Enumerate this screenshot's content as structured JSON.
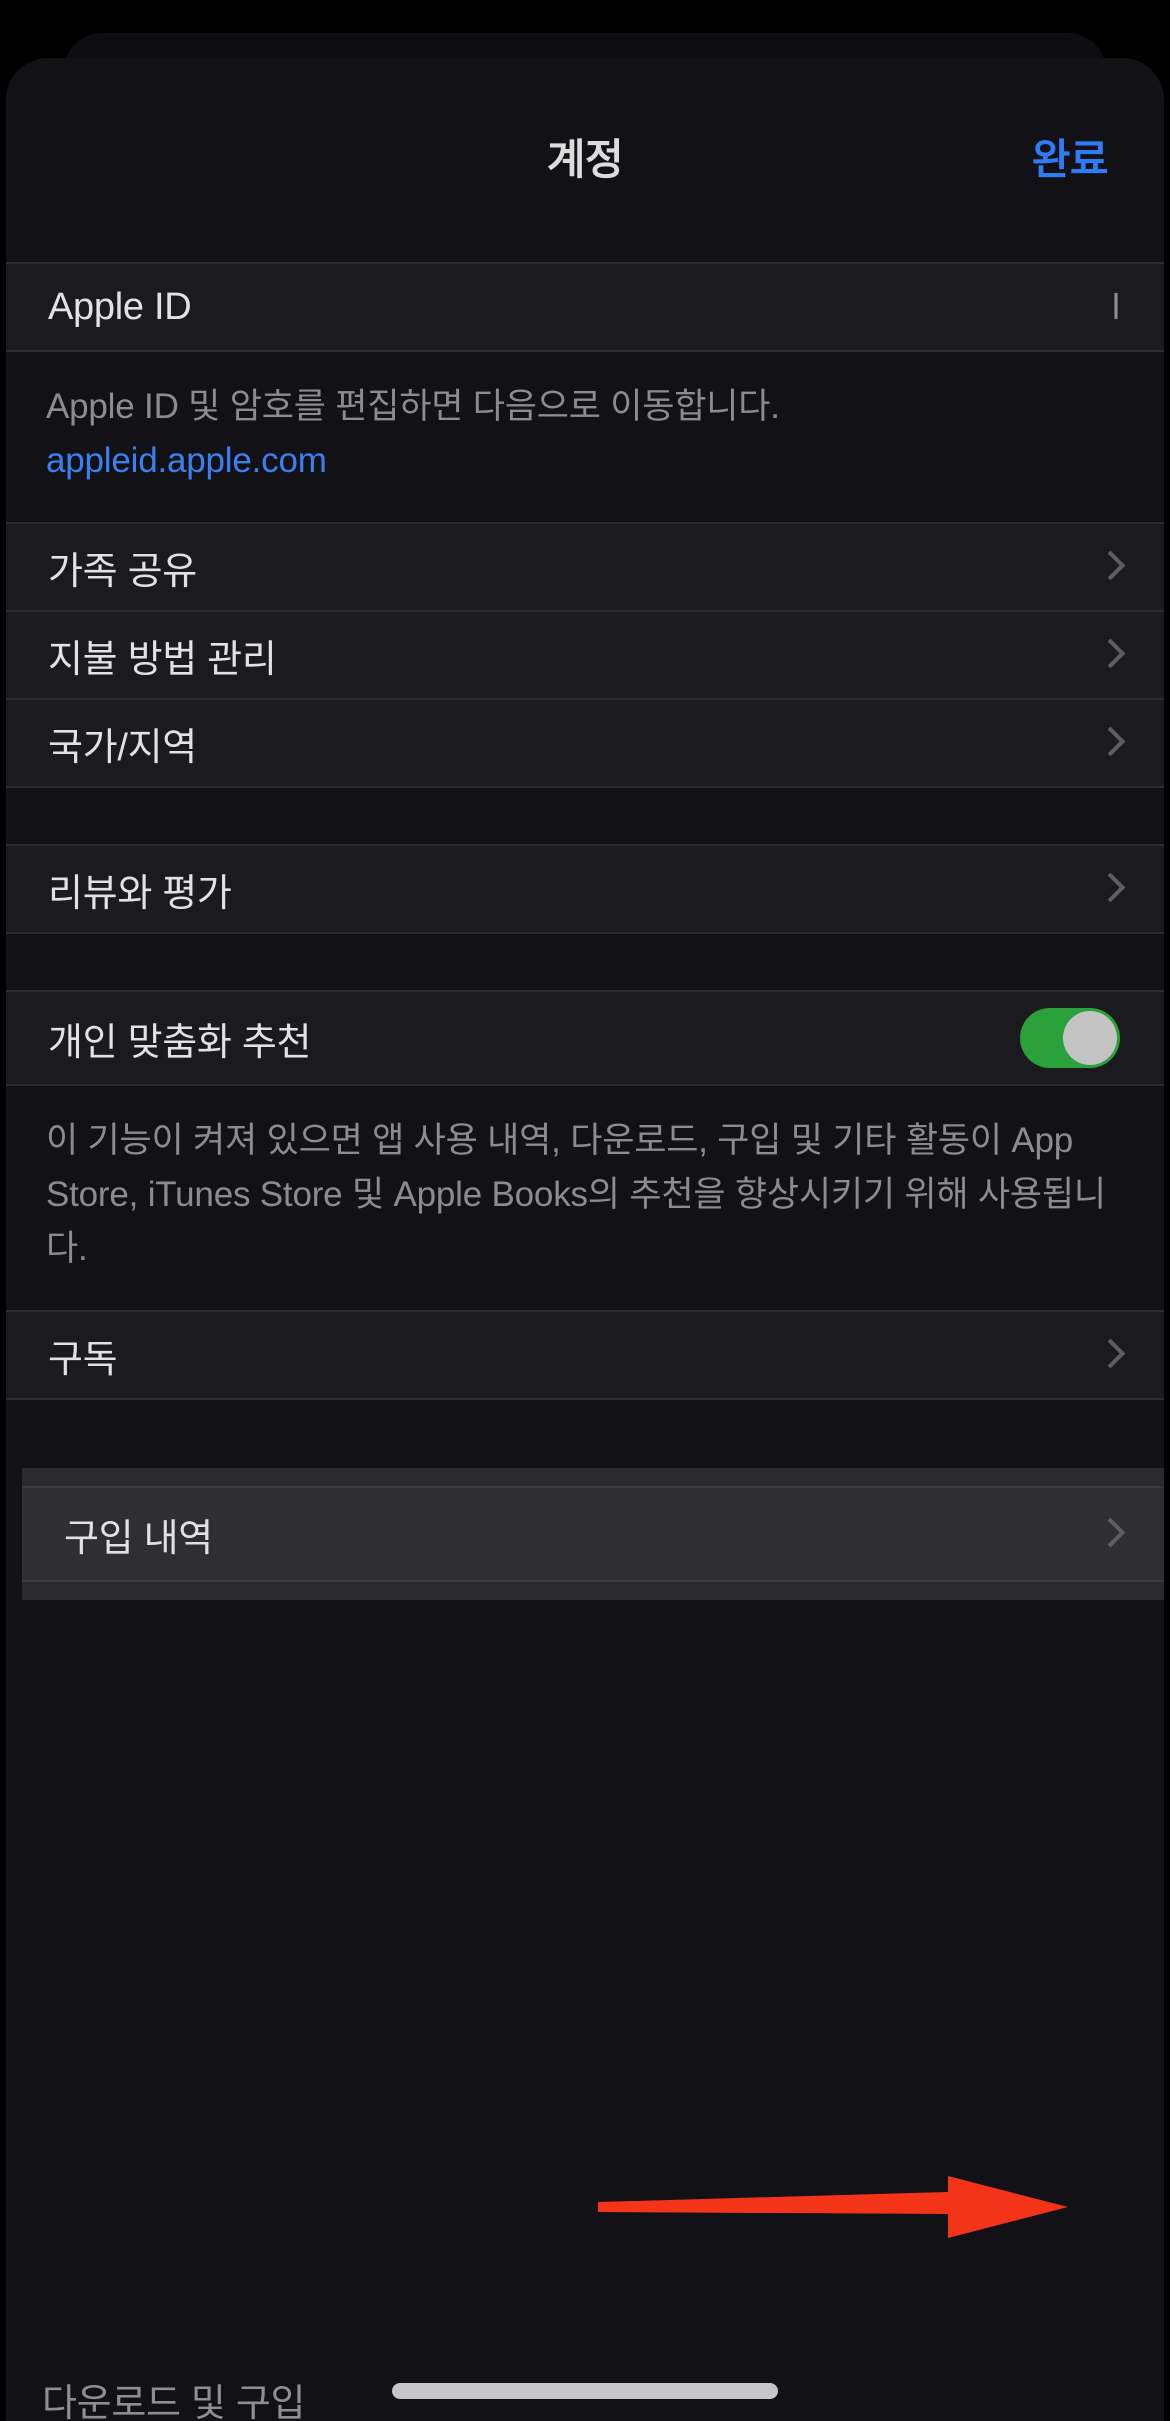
{
  "navbar": {
    "title": "계정",
    "done_label": "완료"
  },
  "account_section": {
    "apple_id_label": "Apple ID",
    "apple_id_value": "l",
    "footer_text": "Apple ID 및 암호를 편집하면 다음으로 이동합니다.",
    "footer_link": "appleid.apple.com"
  },
  "management_section": {
    "items": [
      {
        "label": "가족 공유",
        "accessory": "chevron-right-icon"
      },
      {
        "label": "지불 방법 관리",
        "accessory": "chevron-right-icon"
      },
      {
        "label": "국가/지역",
        "accessory": "chevron-right-icon"
      }
    ]
  },
  "reviews_section": {
    "items": [
      {
        "label": "리뷰와 평가",
        "accessory": "chevron-right-icon"
      }
    ]
  },
  "personalization_section": {
    "label": "개인 맞춤화 추천",
    "toggle_on": true,
    "footer_text": "이 기능이 켜져 있으면 앱 사용 내역, 다운로드, 구입 및 기타 활동이 App Store, iTunes Store 및 Apple Books의 추천을 향상시키기 위해 사용됩니다."
  },
  "subscription_section": {
    "items": [
      {
        "label": "구독",
        "accessory": "chevron-right-icon"
      }
    ]
  },
  "purchase_section": {
    "label": "구입 내역",
    "accessory": "chevron-right-icon",
    "highlighted": true
  },
  "bottom_section": {
    "header": "다운로드 및 구입"
  },
  "annotation": {
    "arrow_color": "#F43418",
    "points_to": "구입 내역"
  },
  "colors": {
    "background": "#000000",
    "sheet": "#121216",
    "row": "#1b1b1f",
    "row_highlighted": "#2f2f33",
    "separator": "#2b2b30",
    "primary_text": "#e2e2e4",
    "secondary_text": "#8b8b90",
    "accent_blue": "#2f7df6",
    "link_blue": "#3b7ff0",
    "toggle_green": "#2aa13a",
    "chevron": "#5d5d62",
    "annotation_red": "#F43418"
  }
}
